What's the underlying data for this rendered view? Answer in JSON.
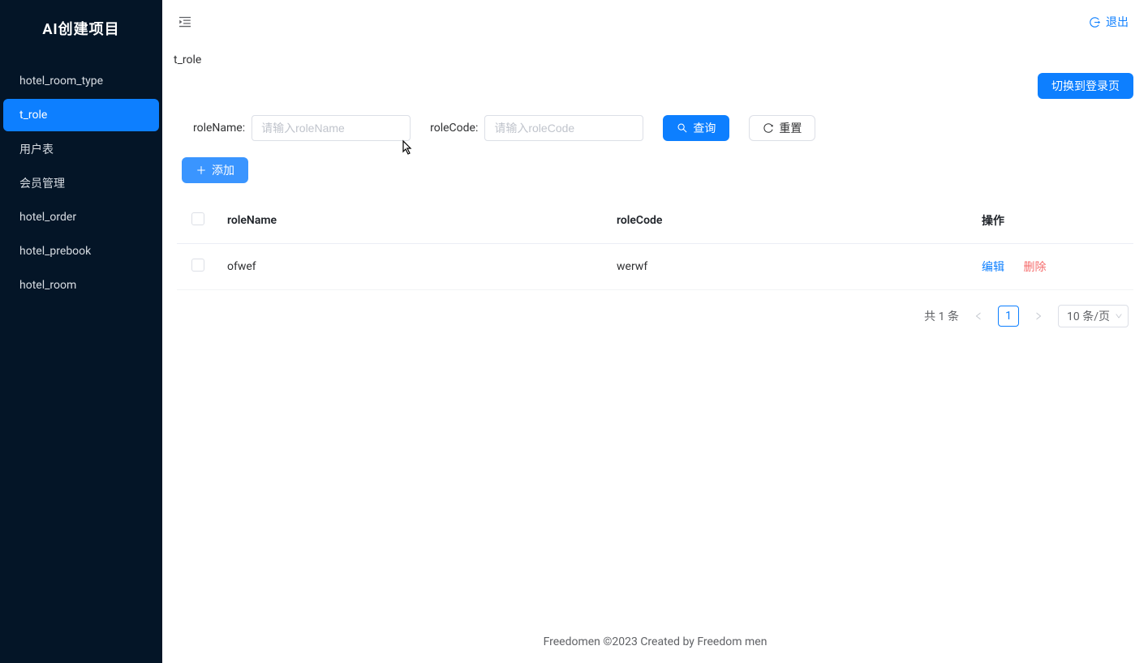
{
  "sidebar": {
    "logo": "AI创建项目",
    "items": [
      {
        "label": "hotel_room_type",
        "active": false
      },
      {
        "label": "t_role",
        "active": true
      },
      {
        "label": "用户表",
        "active": false
      },
      {
        "label": "会员管理",
        "active": false
      },
      {
        "label": "hotel_order",
        "active": false
      },
      {
        "label": "hotel_prebook",
        "active": false
      },
      {
        "label": "hotel_room",
        "active": false
      }
    ]
  },
  "topbar": {
    "logout_label": "退出"
  },
  "breadcrumb": "t_role",
  "toolbar": {
    "switch_login_label": "切换到登录页"
  },
  "search": {
    "roleName_label": "roleName:",
    "roleName_placeholder": "请输入roleName",
    "roleCode_label": "roleCode:",
    "roleCode_placeholder": "请输入roleCode",
    "query_label": "查询",
    "reset_label": "重置"
  },
  "add": {
    "label": "添加"
  },
  "table": {
    "columns": {
      "roleName": "roleName",
      "roleCode": "roleCode",
      "action": "操作"
    },
    "rows": [
      {
        "roleName": "ofwef",
        "roleCode": "werwf"
      }
    ],
    "actions": {
      "edit": "编辑",
      "delete": "删除"
    }
  },
  "pagination": {
    "total_text": "共 1 条",
    "current_page": "1",
    "page_size_label": "10 条/页"
  },
  "footer": "Freedomen ©2023 Created by Freedom men"
}
